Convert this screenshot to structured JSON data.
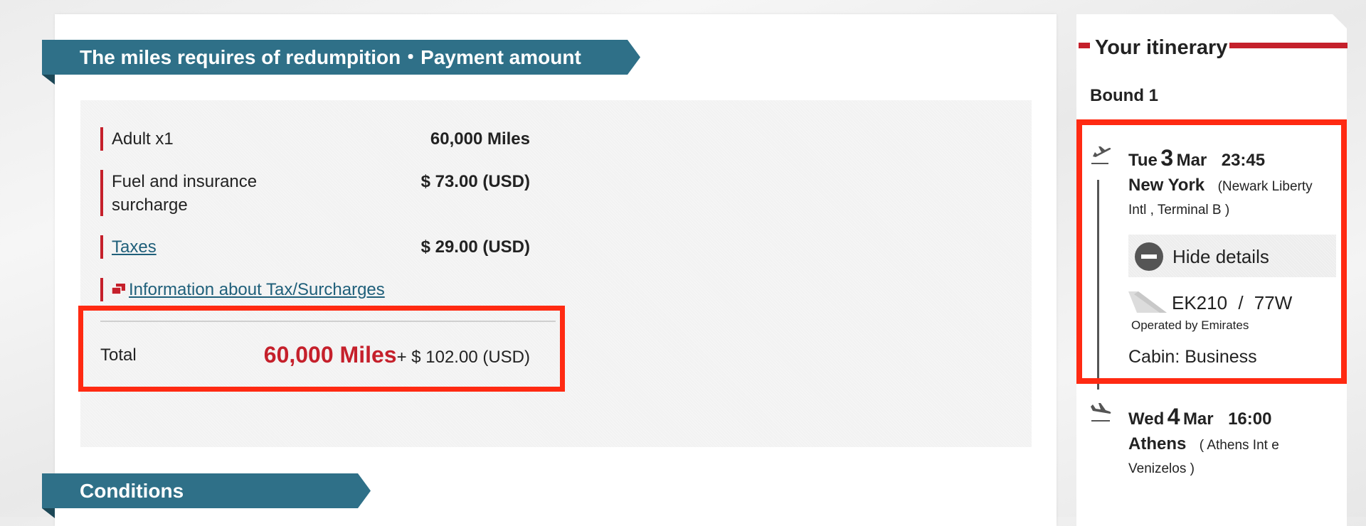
{
  "payment": {
    "heading": "The miles requires of redumpition・Payment amount",
    "rows": [
      {
        "label": "Adult x1",
        "value": "60,000 Miles"
      },
      {
        "label": "Fuel and insurance surcharge",
        "value": "$ 73.00 (USD)"
      },
      {
        "label": "Taxes",
        "value": "$ 29.00 (USD)"
      }
    ],
    "info_link": "Information about Tax/Surcharges",
    "total": {
      "label": "Total",
      "miles": "60,000 Miles",
      "cash": "+ $ 102.00 (USD)"
    }
  },
  "conditions": {
    "heading": "Conditions"
  },
  "itinerary": {
    "title": "Your itinerary",
    "bound": "Bound 1",
    "departure": {
      "weekday": "Tue",
      "day": "3",
      "month": "Mar",
      "time": "23:45",
      "city": "New York",
      "airport_line1": "(Newark Liberty",
      "airport_line2": "Intl ,  Terminal B )"
    },
    "hide_details": "Hide details",
    "flight": {
      "number": "EK210",
      "separator": "/",
      "aircraft": "77W",
      "operator": "Operated by Emirates",
      "cabin": "Cabin: Business"
    },
    "arrival": {
      "weekday": "Wed",
      "day": "4",
      "month": "Mar",
      "time": "16:00",
      "city": "Athens",
      "airport_line1": "( Athens Int e",
      "airport_line2": "Venizelos )"
    }
  },
  "colors": {
    "banner": "#2f7088",
    "accent_red": "#c5202b",
    "highlight": "#ff2a12",
    "link": "#1f5f7a"
  },
  "icons": [
    "document-stack-icon",
    "takeoff-icon",
    "landing-icon",
    "minus-circle-icon",
    "tail-fin-icon"
  ]
}
